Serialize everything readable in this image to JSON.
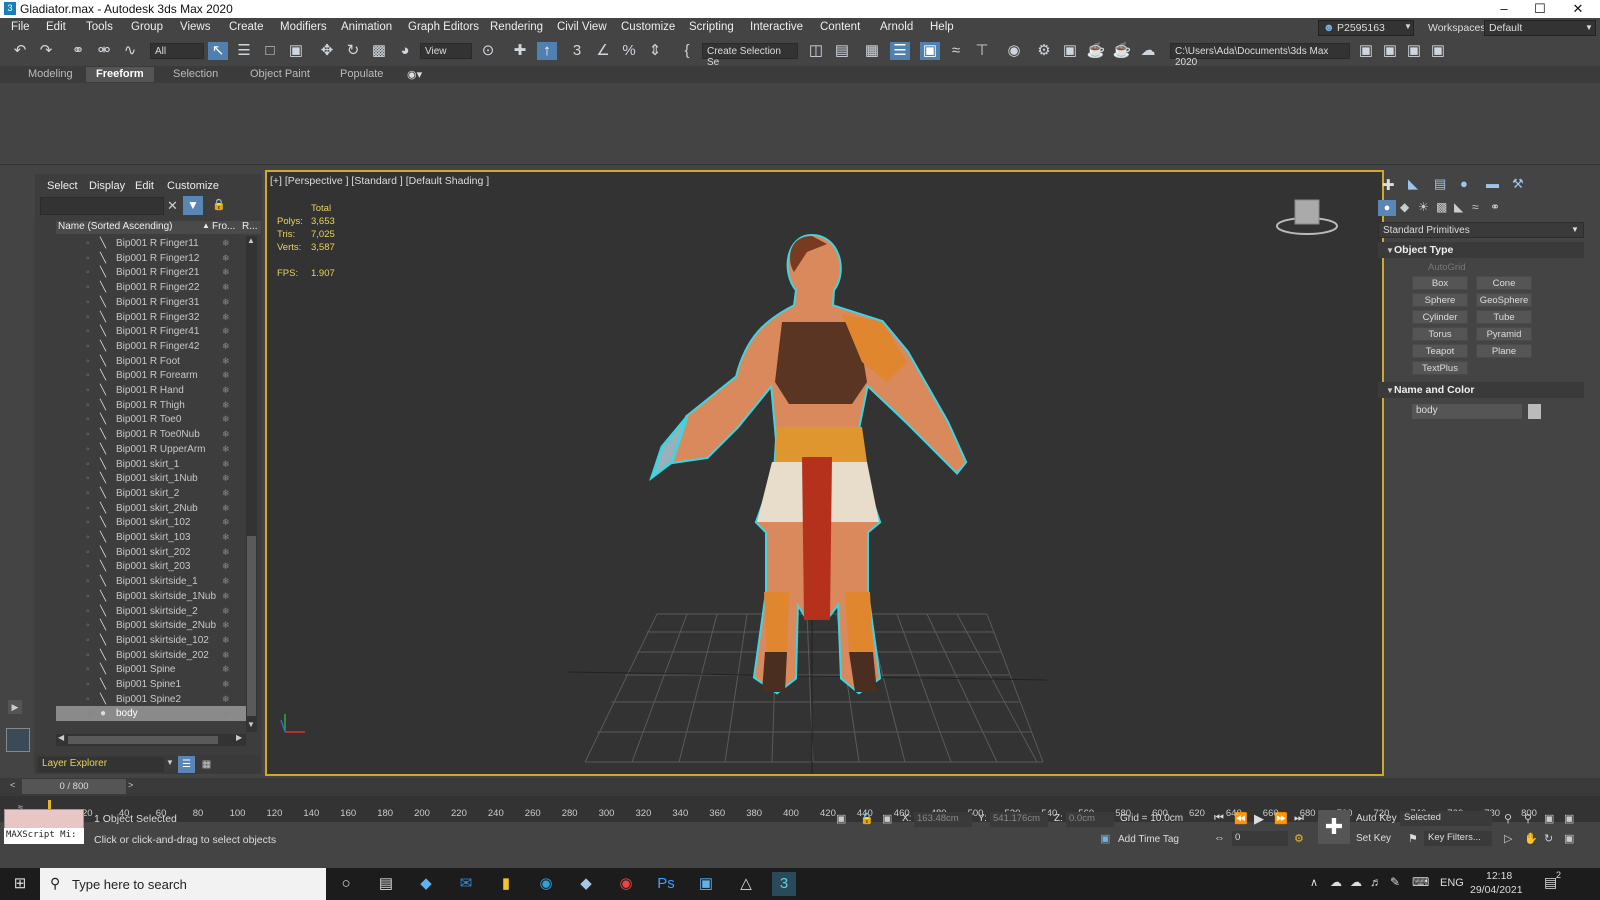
{
  "window": {
    "title": "Gladiator.max - Autodesk 3ds Max 2020"
  },
  "menu": [
    "File",
    "Edit",
    "Tools",
    "Group",
    "Views",
    "Create",
    "Modifiers",
    "Animation",
    "Graph Editors",
    "Rendering",
    "Civil View",
    "Customize",
    "Scripting",
    "Interactive",
    "Content",
    "Arnold",
    "Help"
  ],
  "user": "P2595163",
  "workspace_label": "Workspaces:",
  "workspace_value": "Default",
  "toolbar": {
    "filter": "All",
    "view": "View",
    "selection_set": "Create Selection Se",
    "project_path": "C:\\Users\\Ada\\Documents\\3ds Max 2020"
  },
  "ribbon_tabs": [
    "Modeling",
    "Freeform",
    "Selection",
    "Object Paint",
    "Populate"
  ],
  "scene_explorer": {
    "tabs": [
      "Select",
      "Display",
      "Edit",
      "Customize"
    ],
    "col_name": "Name (Sorted Ascending)",
    "col_frozen": "Fro...",
    "col_r": "R...",
    "items": [
      "Bip001 R Finger11",
      "Bip001 R Finger12",
      "Bip001 R Finger21",
      "Bip001 R Finger22",
      "Bip001 R Finger31",
      "Bip001 R Finger32",
      "Bip001 R Finger41",
      "Bip001 R Finger42",
      "Bip001 R Foot",
      "Bip001 R Forearm",
      "Bip001 R Hand",
      "Bip001 R Thigh",
      "Bip001 R Toe0",
      "Bip001 R Toe0Nub",
      "Bip001 R UpperArm",
      "Bip001 skirt_1",
      "Bip001 skirt_1Nub",
      "Bip001 skirt_2",
      "Bip001 skirt_2Nub",
      "Bip001 skirt_102",
      "Bip001 skirt_103",
      "Bip001 skirt_202",
      "Bip001 skirt_203",
      "Bip001 skirtside_1",
      "Bip001 skirtside_1Nub",
      "Bip001 skirtside_2",
      "Bip001 skirtside_2Nub",
      "Bip001 skirtside_102",
      "Bip001 skirtside_202",
      "Bip001 Spine",
      "Bip001 Spine1",
      "Bip001 Spine2",
      "body"
    ],
    "selected": "body",
    "layer_explorer": "Layer Explorer"
  },
  "viewport": {
    "label": "[+] [Perspective ] [Standard ] [Default Shading ]",
    "stats": {
      "total": "Total",
      "polys_label": "Polys:",
      "polys": "3,653",
      "tris_label": "Tris:",
      "tris": "7,025",
      "verts_label": "Verts:",
      "verts": "3,587",
      "fps_label": "FPS:",
      "fps": "1.907"
    }
  },
  "command_panel": {
    "category": "Standard Primitives",
    "object_type": "Object Type",
    "autogrid": "AutoGrid",
    "buttons": [
      "Box",
      "Cone",
      "Sphere",
      "GeoSphere",
      "Cylinder",
      "Tube",
      "Torus",
      "Pyramid",
      "Teapot",
      "Plane",
      "TextPlus"
    ],
    "name_color": "Name and Color",
    "object_name": "body"
  },
  "time": {
    "frame": "0 / 800",
    "ticks": [
      "20",
      "40",
      "60",
      "80",
      "100",
      "120",
      "140",
      "160",
      "180",
      "200",
      "220",
      "240",
      "260",
      "280",
      "300",
      "320",
      "340",
      "360",
      "380",
      "400",
      "420",
      "440",
      "460",
      "480",
      "500",
      "520",
      "540",
      "560",
      "580",
      "600",
      "620",
      "640",
      "660",
      "680",
      "700",
      "720",
      "740",
      "760",
      "780",
      "800"
    ]
  },
  "status": {
    "maxscript": "MAXScript Mi:",
    "selected": "1 Object Selected",
    "prompt": "Click or click-and-drag to select objects",
    "x_label": "X:",
    "x": "163.48cm",
    "y_label": "Y:",
    "y": "541.176cm",
    "z_label": "Z:",
    "z": "0.0cm",
    "grid": "Grid = 10.0cm",
    "add_time_tag": "Add Time Tag",
    "auto_key": "Auto Key",
    "set_key": "Set Key",
    "key_mode": "Selected",
    "key_filters": "Key Filters...",
    "frame_field": "0"
  },
  "taskbar": {
    "search": "Type here to search",
    "lang": "ENG",
    "time": "12:18",
    "date": "29/04/2021",
    "notif": "2"
  }
}
